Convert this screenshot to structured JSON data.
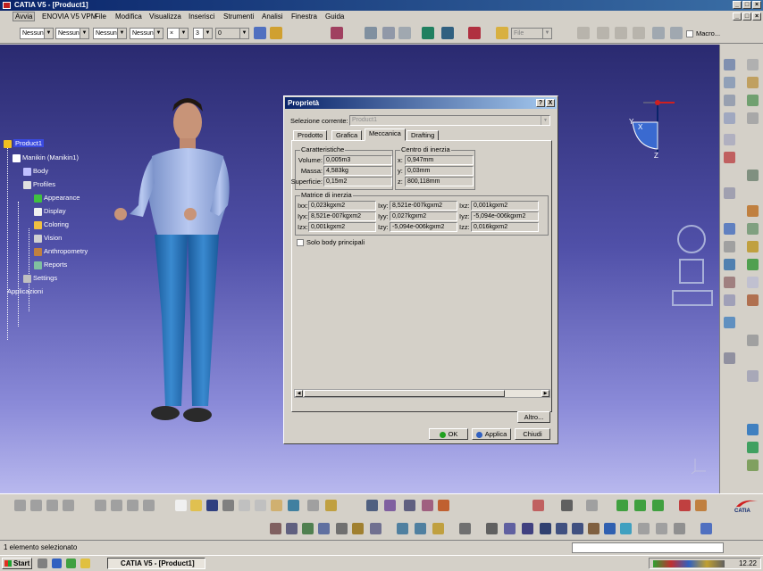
{
  "window": {
    "title": "CATIA V5 - [Product1]"
  },
  "menu": [
    "Avvia",
    "ENOVIA V5 VPM",
    "File",
    "Modifica",
    "Visualizza",
    "Inserisci",
    "Strumenti",
    "Analisi",
    "Finestra",
    "Guida"
  ],
  "toolbar": {
    "combos": [
      "Nessun",
      "Nessun",
      "Nessun",
      "Nessun"
    ],
    "linewidth_combo": "3",
    "layer_combo": "0",
    "file_combo": "File",
    "macro_label": "Macro..."
  },
  "tree": {
    "root": "Product1",
    "items": [
      "Manikin (Manikin1)",
      "Body",
      "Profiles",
      "Appearance",
      "Display",
      "Coloring",
      "Vision",
      "Anthropometry",
      "Reports",
      "Settings",
      "Applicazioni"
    ]
  },
  "dialog": {
    "title": "Proprietà",
    "help_btn": "?",
    "close_btn": "X",
    "selection_label": "Selezione corrente:",
    "selection_value": "Product1",
    "tabs": [
      "Prodotto",
      "Grafica",
      "Meccanica",
      "Drafting"
    ],
    "active_tab": "Meccanica",
    "characteristics": {
      "title": "Caratteristiche",
      "volume_label": "Volume:",
      "volume": "0,005m3",
      "mass_label": "Massa:",
      "mass": "4,583kg",
      "surface_label": "Superficie:",
      "surface": "0,15m2"
    },
    "center": {
      "title": "Centro di inerzia",
      "x_label": "x:",
      "x": "0,947mm",
      "y_label": "y:",
      "y": "0,03mm",
      "z_label": "z:",
      "z": "800,118mm"
    },
    "matrix": {
      "title": "Matrice di inerzia",
      "cells": [
        {
          "label": "Ixx:",
          "value": "0,023kgxm2"
        },
        {
          "label": "Ixy:",
          "value": "8,521e-007kgxm2"
        },
        {
          "label": "Ixz:",
          "value": "0,001kgxm2"
        },
        {
          "label": "Iyx:",
          "value": "8,521e-007kgxm2"
        },
        {
          "label": "Iyy:",
          "value": "0,027kgxm2"
        },
        {
          "label": "Iyz:",
          "value": "-5,094e-006kgxm2"
        },
        {
          "label": "Izx:",
          "value": "0,001kgxm2"
        },
        {
          "label": "Izy:",
          "value": "-5,094e-006kgxm2"
        },
        {
          "label": "Izz:",
          "value": "0,016kgxm2"
        }
      ]
    },
    "only_main_body": "Solo body principali",
    "other_btn": "Altro...",
    "ok_btn": "OK",
    "apply_btn": "Applica",
    "close_dialog_btn": "Chiudi"
  },
  "compass": {
    "x": "X",
    "y": "Y",
    "z": "Z"
  },
  "status": {
    "text": "1 elemento selezionato"
  },
  "taskbar": {
    "start": "Start",
    "task": "CATIA V5 - [Product1]",
    "clock": "12.22"
  },
  "catia_logo": "CATIA"
}
